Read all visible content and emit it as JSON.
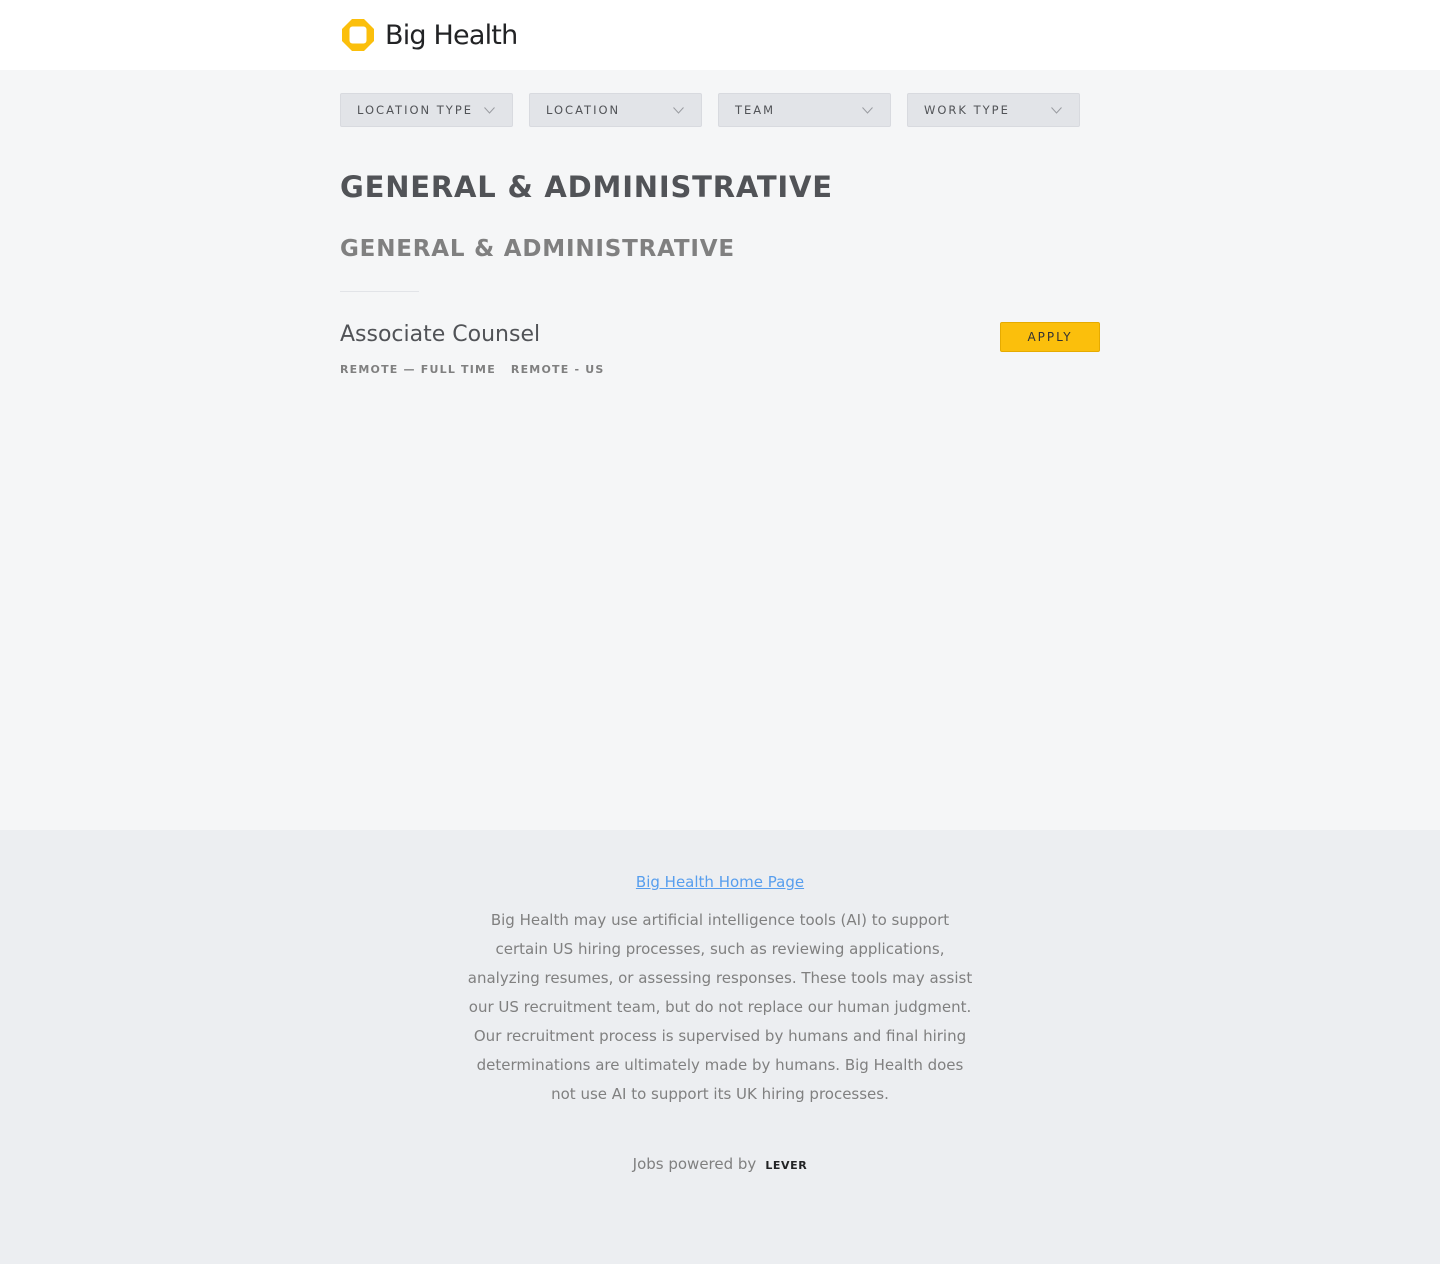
{
  "brand": {
    "name": "Big Health",
    "accent_color": "#fbbf0c",
    "logo_icon": "rounded-square-logo-icon"
  },
  "filters": [
    {
      "label": "LOCATION TYPE"
    },
    {
      "label": "LOCATION"
    },
    {
      "label": "TEAM"
    },
    {
      "label": "WORK TYPE"
    }
  ],
  "page_title": "GENERAL & ADMINISTRATIVE",
  "group": {
    "title": "GENERAL & ADMINISTRATIVE",
    "postings": [
      {
        "title": "Associate Counsel",
        "tags": [
          "REMOTE — FULL TIME",
          "REMOTE - US"
        ],
        "apply_label": "APPLY"
      }
    ]
  },
  "footer": {
    "home_link": "Big Health Home Page",
    "disclaimer": "Big Health may use artificial intelligence tools (AI) to support certain US hiring processes, such as reviewing applications, analyzing resumes, or assessing responses. These tools may assist our US recruitment team, but do not replace our human judgment. Our recruitment process is supervised by humans and final hiring determinations are ultimately made by humans. Big Health does not use AI to support its UK hiring processes.",
    "powered_by": "Jobs powered by",
    "lever_logo": "LEVER",
    "link_color": "#579eee"
  }
}
